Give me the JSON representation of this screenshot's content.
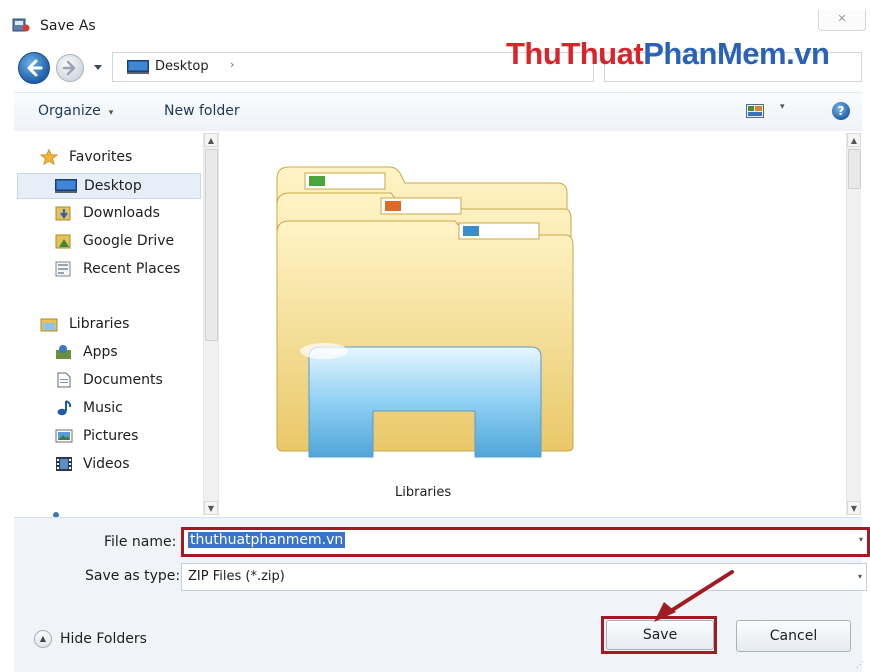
{
  "window": {
    "title": "Save As",
    "close_glyph": "✕"
  },
  "address_bar": {
    "location": "Desktop",
    "chevron": "›"
  },
  "watermark": {
    "part1": "ThuThuat",
    "part2": "PhanMem.vn",
    "color_primary": "#d9242a",
    "color_secondary": "#2a62b8"
  },
  "toolbar": {
    "organize_label": "Organize",
    "organize_caret": "▾",
    "new_folder_label": "New folder",
    "view_caret": "▾",
    "help_label": "?"
  },
  "nav_pane": {
    "favorites": {
      "header": "Favorites",
      "items": [
        {
          "label": "Desktop",
          "icon": "desktop-icon",
          "selected": true
        },
        {
          "label": "Downloads",
          "icon": "downloads-icon"
        },
        {
          "label": "Google Drive",
          "icon": "google-drive-icon"
        },
        {
          "label": "Recent Places",
          "icon": "recent-places-icon"
        }
      ]
    },
    "libraries": {
      "header": "Libraries",
      "items": [
        {
          "label": "Apps",
          "icon": "apps-icon"
        },
        {
          "label": "Documents",
          "icon": "documents-icon"
        },
        {
          "label": "Music",
          "icon": "music-icon"
        },
        {
          "label": "Pictures",
          "icon": "pictures-icon"
        },
        {
          "label": "Videos",
          "icon": "videos-icon"
        }
      ]
    }
  },
  "content": {
    "items": [
      {
        "label": "Libraries",
        "icon": "libraries-folder-icon"
      }
    ]
  },
  "form": {
    "filename_label": "File name:",
    "filename_value": "thuthuatphanmem.vn",
    "save_as_type_label": "Save as type:",
    "save_as_type_value": "ZIP Files (*.zip)",
    "dropdown_caret": "▾"
  },
  "footer": {
    "hide_folders_label": "Hide Folders",
    "hide_folders_glyph": "▲",
    "save_label": "Save",
    "cancel_label": "Cancel"
  },
  "annotations": {
    "highlight_color": "#a21b22"
  }
}
